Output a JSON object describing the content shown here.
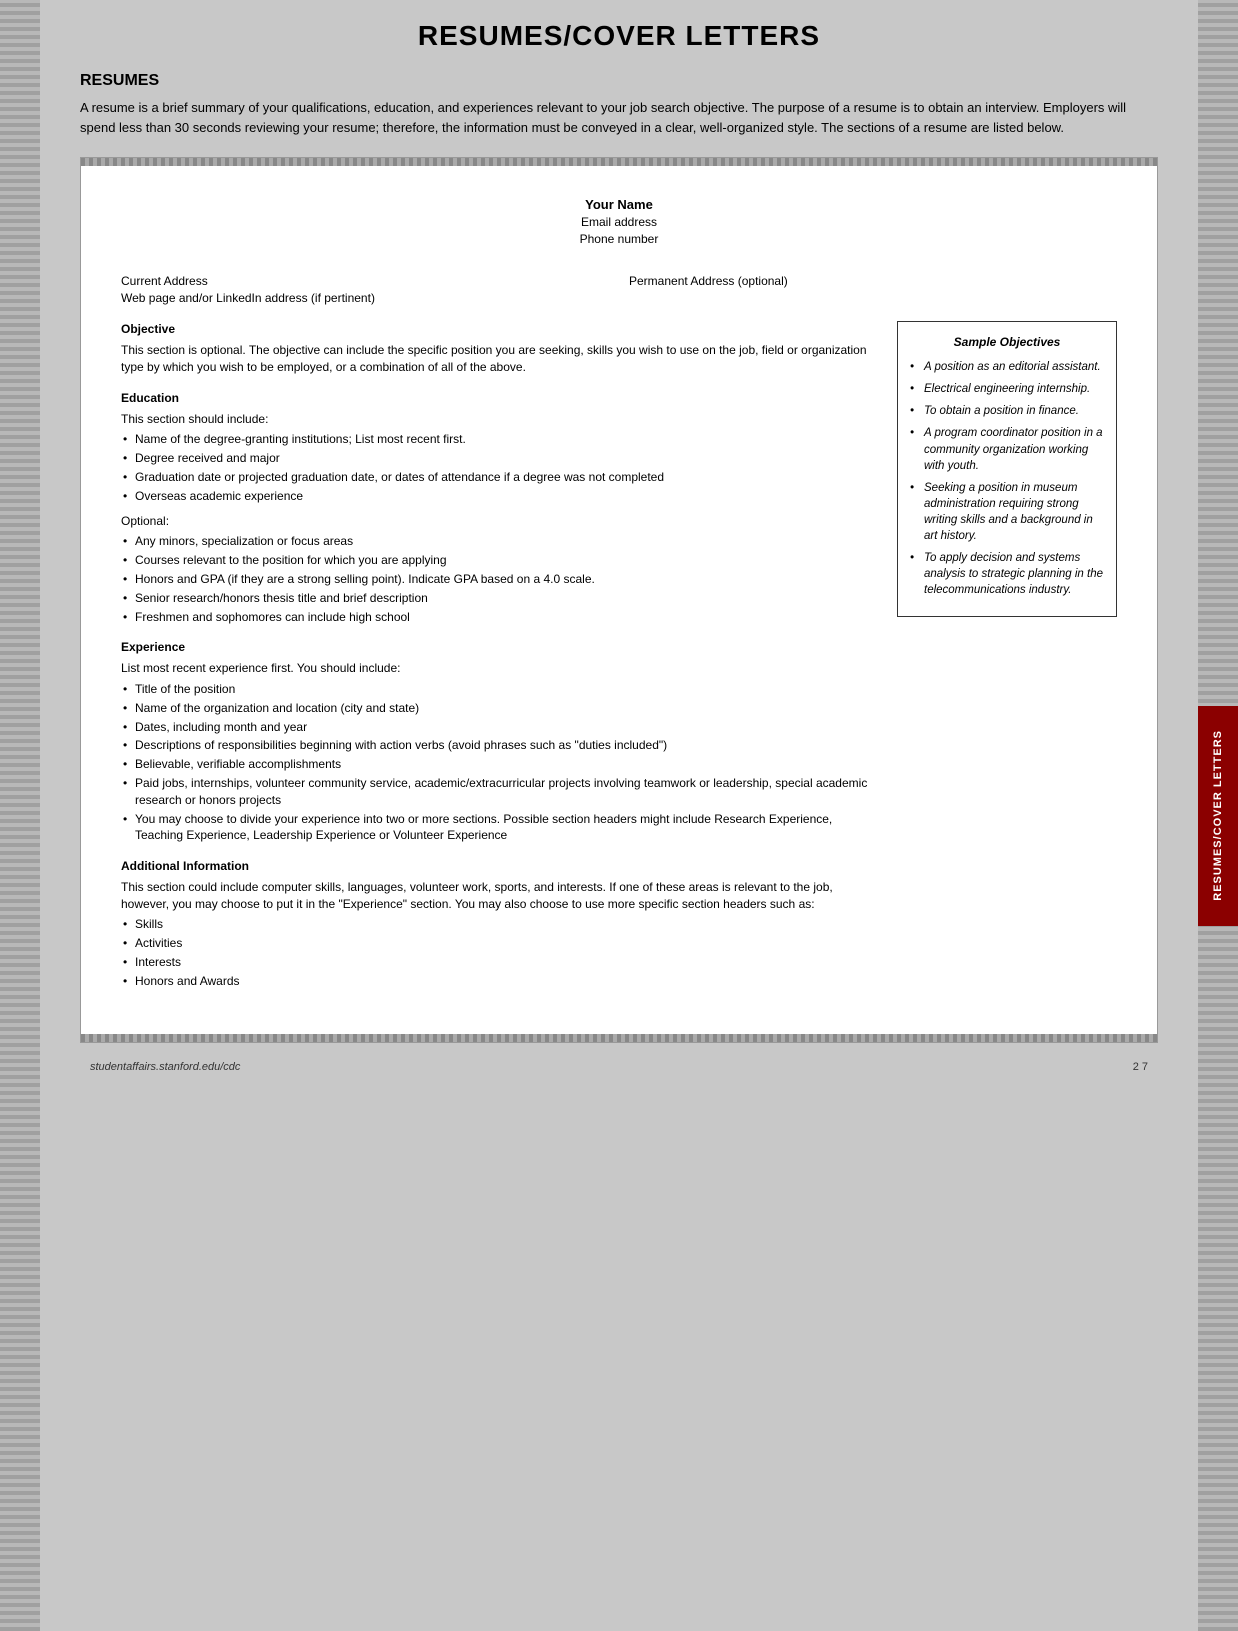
{
  "page": {
    "title": "RESUMES/COVER LETTERS",
    "background_color": "#c8c8c8"
  },
  "resumes_section": {
    "heading": "RESUMES",
    "intro": "A resume is a brief summary of your qualifications, education, and experiences relevant to your job search objective. The purpose of a resume is to obtain an interview. Employers will spend less than 30 seconds reviewing your resume; therefore, the information must be conveyed in a clear, well-organized style. The sections of a resume are listed below."
  },
  "document": {
    "header": {
      "name": "Your Name",
      "email": "Email address",
      "phone": "Phone number"
    },
    "address_left": "Current Address",
    "address_left_sub": "Web page and/or LinkedIn address (if pertinent)",
    "address_right": "Permanent Address (optional)",
    "objective_section": {
      "label": "Objective",
      "text": "This section is optional. The objective can include the specific position you are seeking, skills you wish to use on the job, field or organization type by which you wish to be employed, or a combination of all of the above."
    },
    "education_section": {
      "label": "Education",
      "intro": "This section should include:",
      "items": [
        "Name of the degree-granting institutions; List most recent first.",
        "Degree received and major",
        "Graduation date or projected graduation date, or dates of attendance if a degree was not completed",
        "Overseas academic experience"
      ],
      "optional_label": "Optional:",
      "optional_items": [
        "Any minors, specialization or focus areas",
        "Courses relevant to the position for which you are applying",
        "Honors and GPA (if they are a strong selling point). Indicate GPA based on a 4.0 scale.",
        "Senior research/honors thesis title and brief description",
        "Freshmen and sophomores can include high school"
      ]
    },
    "experience_section": {
      "label": "Experience",
      "intro": "List most recent experience first. You should include:",
      "items": [
        "Title of the position",
        "Name of the organization and location (city and state)",
        "Dates, including month and year",
        "Descriptions of responsibilities beginning with action verbs (avoid phrases such as \"duties included\")",
        "Believable, verifiable accomplishments",
        "Paid jobs, internships, volunteer community service, academic/extracurricular projects involving teamwork or leadership, special academic research or honors projects",
        "You may choose to divide your experience into two or more sections. Possible section headers might include Research Experience, Teaching Experience, Leadership Experience or Volunteer Experience"
      ]
    },
    "additional_section": {
      "label": "Additional Information",
      "text": "This section could include computer skills, languages, volunteer work, sports, and interests. If one of these areas is relevant to the job, however, you may choose to put it in the \"Experience\" section. You may also choose to use more specific section headers such as:",
      "items": [
        "Skills",
        "Activities",
        "Interests",
        "Honors and Awards"
      ]
    }
  },
  "sample_objectives": {
    "title": "Sample Objectives",
    "items": [
      "A position as an editorial assistant.",
      "Electrical engineering internship.",
      "To obtain a position in finance.",
      "A program coordinator position in a community organization working with youth.",
      "Seeking a position in museum administration requiring strong writing skills and a background in art history.",
      "To apply decision and systems analysis to strategic planning in the telecommunications industry."
    ]
  },
  "vertical_tab": {
    "text": "RESUMES/COVER LETTERS"
  },
  "footer": {
    "url": "studentaffairs.stanford.edu/cdc",
    "page": "2 7"
  }
}
